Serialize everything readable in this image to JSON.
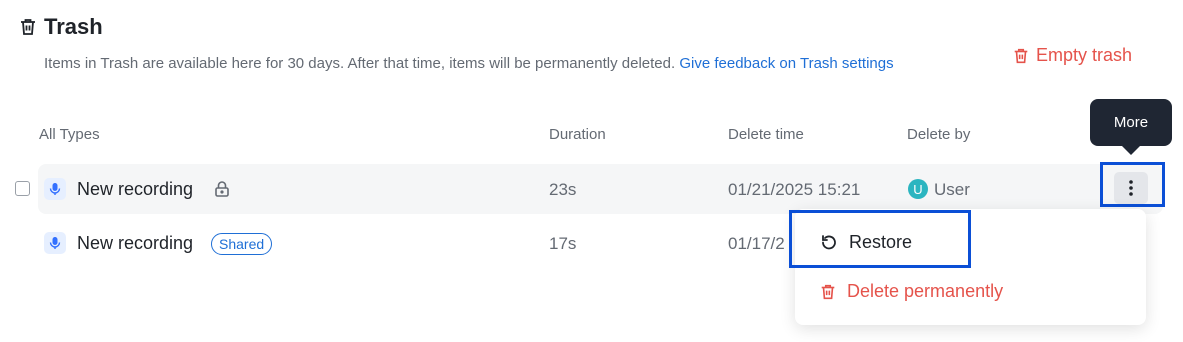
{
  "header": {
    "title": "Trash",
    "icon": "trash-icon"
  },
  "description": {
    "text": "Items in Trash are available here for 30 days. After that time, items will be permanently deleted.",
    "feedback_link": "Give feedback on Trash settings"
  },
  "actions": {
    "empty_trash": "Empty trash"
  },
  "columns": {
    "type": "All Types",
    "duration": "Duration",
    "delete_time": "Delete time",
    "delete_by": "Delete by"
  },
  "rows": [
    {
      "name": "New recording",
      "duration": "23s",
      "delete_time": "01/21/2025 15:21",
      "delete_by": "User",
      "avatar_initial": "U",
      "locked": true
    },
    {
      "name": "New recording",
      "badge": "Shared",
      "duration": "17s",
      "delete_time": "01/17/2"
    }
  ],
  "tooltip": {
    "text": "More"
  },
  "context_menu": {
    "restore": "Restore",
    "delete_permanently": "Delete permanently"
  },
  "colors": {
    "accent": "#1f6fd6",
    "danger": "#e5534b",
    "highlight": "#0b4fd6",
    "tooltip_bg": "#1f2633",
    "avatar": "#2bb5c0"
  }
}
